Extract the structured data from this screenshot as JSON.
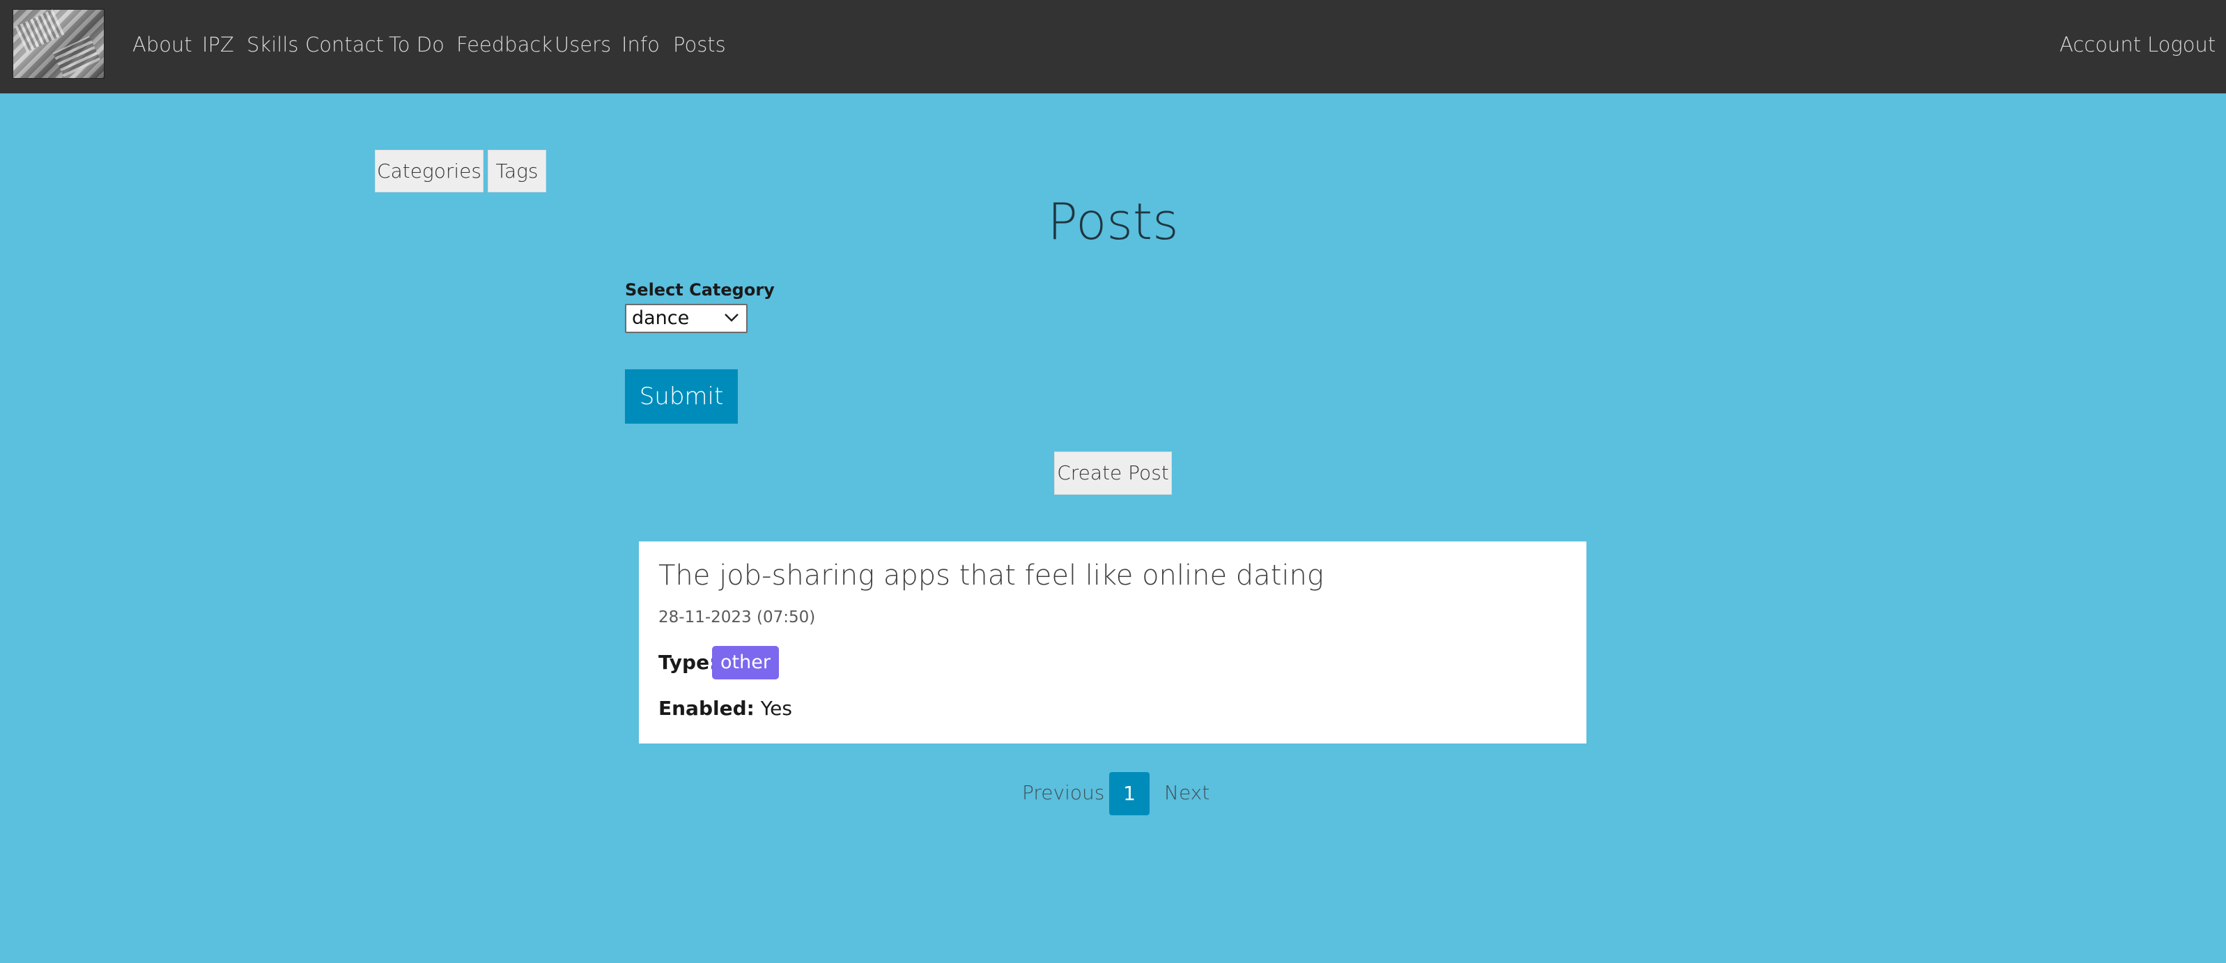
{
  "nav": {
    "links": [
      "About",
      "IPZ",
      "Skills",
      "Contact",
      "To Do",
      "Feedback",
      "Users",
      "Info",
      "Posts"
    ],
    "account": "Account",
    "logout": "Logout"
  },
  "side_buttons": {
    "categories": "Categories",
    "tags": "Tags"
  },
  "page": {
    "title": "Posts"
  },
  "filter": {
    "label": "Select Category",
    "selected": "dance",
    "submit": "Submit"
  },
  "create_post": "Create Post",
  "posts": [
    {
      "title": "The job-sharing apps that feel like online dating",
      "date": "28-11-2023 (07:50)",
      "type_label": "Type:",
      "type": "other",
      "enabled_label": "Enabled:",
      "enabled": "Yes"
    }
  ],
  "pagination": {
    "previous": "Previous",
    "current": "1",
    "next": "Next"
  },
  "colors": {
    "background": "#5bbfde",
    "navbar": "#333333",
    "primary": "#008cba",
    "badge": "#7b68ee"
  }
}
